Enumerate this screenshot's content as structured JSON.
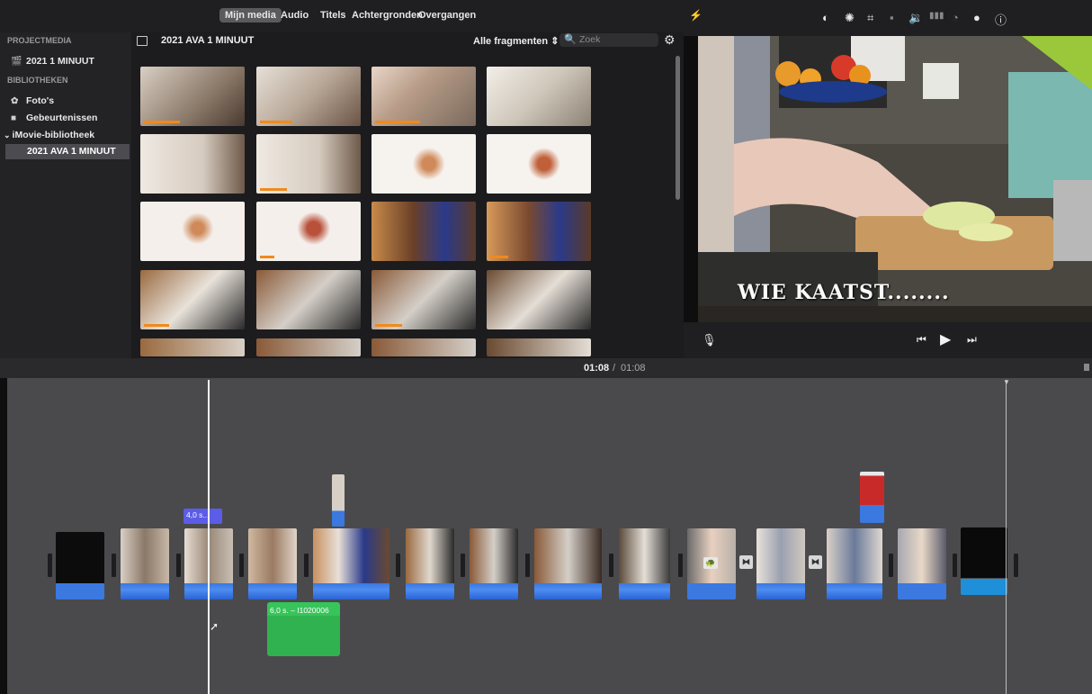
{
  "browser_tabs": [
    "Mijn media",
    "Audio",
    "Titels",
    "Achtergronden",
    "Overgangen"
  ],
  "sidebar": {
    "project_header": "PROJECTMEDIA",
    "project_item": "2021 1 MINUUT",
    "libraries_header": "BIBLIOTHEKEN",
    "items": [
      "Foto's",
      "Gebeurtenissen"
    ],
    "library": "iMovie-bibliotheek",
    "library_event": "2021 AVA 1 MINUUT"
  },
  "browser": {
    "title": "2021 AVA 1 MINUUT",
    "filter": "Alle fragmenten",
    "search_placeholder": "Zoek"
  },
  "viewer": {
    "title_overlay": "WIE KAATST........"
  },
  "timeline": {
    "timecode_current": "01:08",
    "timecode_separator": "/",
    "timecode_total": "01:08",
    "clip_label_1": "4,0 s...",
    "audio_label": "6,0 s. – I1020006"
  },
  "colors": {
    "accent_blue": "#3b78e0",
    "audio_green": "#37c45a",
    "selection_orange": "#f08a1c"
  }
}
